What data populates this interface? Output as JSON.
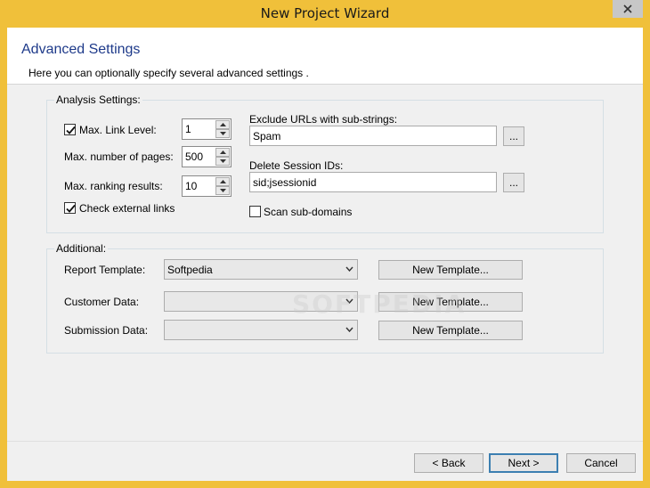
{
  "window": {
    "title": "New Project Wizard"
  },
  "header": {
    "title": "Advanced Settings",
    "description": "Here you can optionally specify several advanced settings ."
  },
  "analysis": {
    "group_title": "Analysis Settings:",
    "max_link_level": {
      "label": "Max. Link Level:",
      "checked": true,
      "value": "1"
    },
    "max_pages": {
      "label": "Max. number of pages:",
      "value": "500"
    },
    "max_ranking": {
      "label": "Max. ranking results:",
      "value": "10"
    },
    "check_external": {
      "label": "Check external links",
      "checked": true
    },
    "exclude_urls": {
      "label": "Exclude URLs with sub-strings:",
      "value": "Spam",
      "browse_label": "..."
    },
    "session_ids": {
      "label": "Delete Session IDs:",
      "value": "sid;jsessionid",
      "browse_label": "..."
    },
    "scan_subdomains": {
      "label": "Scan sub-domains",
      "checked": false
    }
  },
  "additional": {
    "group_title": "Additional:",
    "rows": [
      {
        "label": "Report Template:",
        "value": "Softpedia",
        "button": "New Template..."
      },
      {
        "label": "Customer Data:",
        "value": "",
        "button": "New Template..."
      },
      {
        "label": "Submission Data:",
        "value": "",
        "button": "New Template..."
      }
    ]
  },
  "watermark": "SOFTPEDIA",
  "footer": {
    "back_label": "< Back",
    "next_label": "Next >",
    "cancel_label": "Cancel"
  },
  "colors": {
    "title_bar": "#f0c03a",
    "heading": "#1e3a8a",
    "default_button_border": "#3c7fb1"
  }
}
